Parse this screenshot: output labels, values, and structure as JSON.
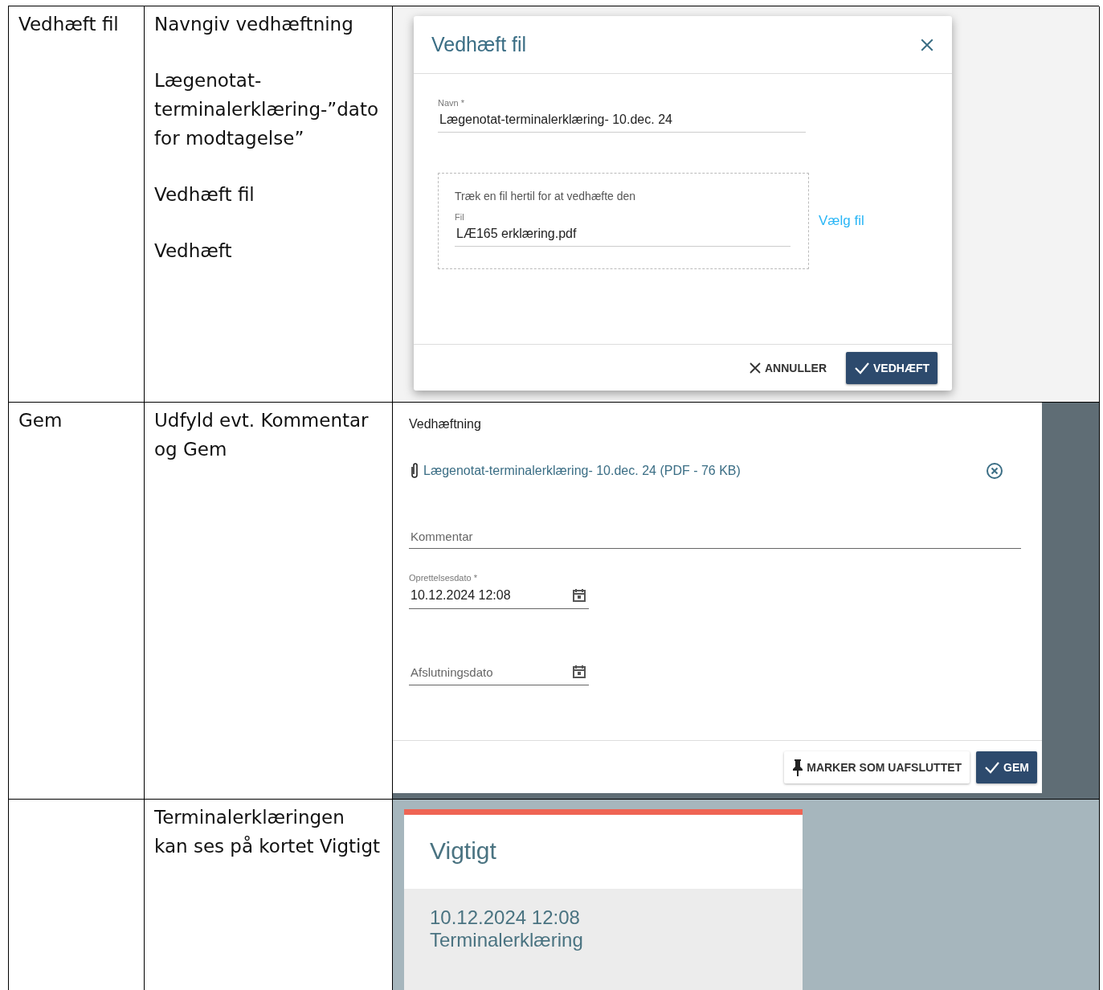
{
  "rows": [
    {
      "step": "Vedhæft fil",
      "instructions": [
        "Navngiv vedhæftning",
        "Lægenotat-terminalerklæring-”dato for modtagelse”",
        "Vedhæft fil",
        "Vedhæft"
      ],
      "panel": {
        "kind": "attach_dialog",
        "title": "Vedhæft fil",
        "name_label": "Navn *",
        "name_value": "Lægenotat-terminalerklæring- 10.dec. 24",
        "drop_hint": "Træk en fil hertil for at vedhæfte den",
        "file_label": "Fil",
        "file_value": "LÆ165 erklæring.pdf",
        "choose_link": "Vælg fil",
        "buttons": [
          {
            "label": "ANNULLER",
            "kind": "cancel"
          },
          {
            "label": "VEDHÆFT",
            "kind": "confirm"
          }
        ]
      }
    },
    {
      "step": "Gem",
      "instructions": [
        "Udfyld evt. Kommentar og Gem"
      ],
      "panel": {
        "kind": "save_form",
        "section_title": "Vedhæftning",
        "attachment": "Lægenotat-terminalerklæring- 10.dec. 24 (PDF - 76 KB)",
        "comment": {
          "placeholder": "Kommentar"
        },
        "created": {
          "label": "Oprettelsesdato *",
          "value": "10.12.2024 12:08"
        },
        "closing": {
          "placeholder": "Afslutningsdato"
        },
        "buttons": [
          {
            "label": "MARKER SOM UAFSLUTTET",
            "kind": "pin"
          },
          {
            "label": "GEM",
            "kind": "confirm"
          }
        ]
      }
    },
    {
      "step": "",
      "instructions": [
        "Terminalerklæringen kan ses på kortet Vigtigt"
      ],
      "panel": {
        "kind": "card",
        "title": "Vigtigt",
        "entry_date": "10.12.2024 12:08",
        "entry_text": "Terminalerklæring"
      }
    }
  ]
}
